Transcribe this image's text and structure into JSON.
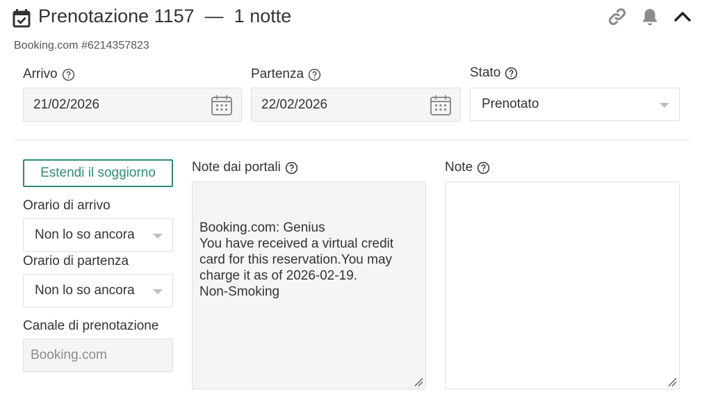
{
  "header": {
    "title": "Prenotazione 1157  —  1 notte",
    "subtitle": "Booking.com #6214357823",
    "icons": [
      "calendar-check-icon",
      "link-icon",
      "bell-icon",
      "chevron-up-icon"
    ]
  },
  "dates": {
    "arrival_label": "Arrivo",
    "arrival_value": "21/02/2026",
    "departure_label": "Partenza",
    "departure_value": "22/02/2026",
    "status_label": "Stato",
    "status_value": "Prenotato"
  },
  "side": {
    "extend_button": "Estendi il soggiorno",
    "arrival_time_label": "Orario di arrivo",
    "arrival_time_value": "Non lo so ancora",
    "departure_time_label": "Orario di partenza",
    "departure_time_value": "Non lo so ancora",
    "channel_label": "Canale di prenotazione",
    "channel_value": "Booking.com"
  },
  "notes": {
    "portal_label": "Note dai portali",
    "portal_text": "Booking.com: Genius\nYou have received a virtual credit card for this reservation.You may charge it as of 2026-02-19.\nNon-Smoking",
    "notes_label": "Note",
    "notes_text": ""
  },
  "colors": {
    "accent": "#2e8b77",
    "icon_gray": "#8c8c8c",
    "text": "#333333"
  }
}
